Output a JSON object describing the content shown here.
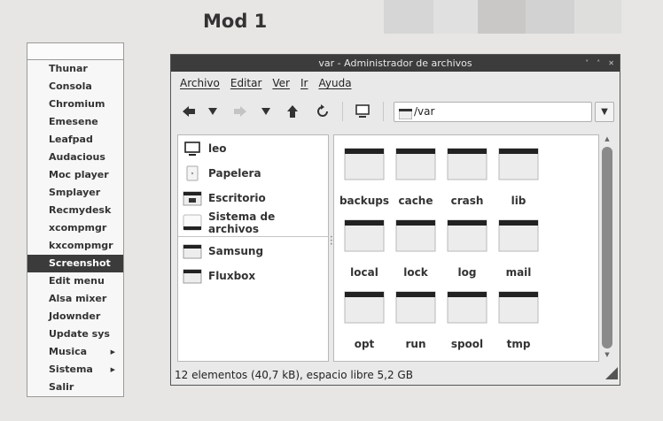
{
  "desktop": {
    "title": "Mod 1",
    "swatches": [
      "#d6d6d6",
      "#e0e0e0",
      "#c9c8c6",
      "#d2d2d2",
      "#dededd"
    ]
  },
  "rootmenu": {
    "items": [
      {
        "label": "Thunar"
      },
      {
        "label": "Consola"
      },
      {
        "label": "Chromium"
      },
      {
        "label": "Emesene"
      },
      {
        "label": "Leafpad"
      },
      {
        "label": "Audacious"
      },
      {
        "label": "Moc player"
      },
      {
        "label": "Smplayer"
      },
      {
        "label": "Recmydesk"
      },
      {
        "label": "xcompmgr"
      },
      {
        "label": "kxcompmgr"
      },
      {
        "label": "Screenshot",
        "active": true
      },
      {
        "label": "Edit menu"
      },
      {
        "label": "Alsa mixer"
      },
      {
        "label": "Jdownder"
      },
      {
        "label": "Update sys"
      },
      {
        "label": "Musica",
        "submenu": true
      },
      {
        "label": "Sistema",
        "submenu": true
      },
      {
        "label": "Salir"
      }
    ]
  },
  "window": {
    "title": "var - Administrador de archivos",
    "menubar": [
      "Archivo",
      "Editar",
      "Ver",
      "Ir",
      "Ayuda"
    ],
    "path": "/var",
    "places": [
      {
        "label": "leo",
        "icon": "computer-icon"
      },
      {
        "label": "Papelera",
        "icon": "trash-icon"
      },
      {
        "label": "Escritorio",
        "icon": "desktop-folder-icon"
      },
      {
        "label": "Sistema de archivos",
        "icon": "drive-icon"
      },
      {
        "label": "Samsung",
        "icon": "folder-icon"
      },
      {
        "label": "Fluxbox",
        "icon": "folder-icon"
      }
    ],
    "files": [
      "backups",
      "cache",
      "crash",
      "lib",
      "local",
      "lock",
      "log",
      "mail",
      "opt",
      "run",
      "spool",
      "tmp"
    ],
    "status": "12 elementos (40,7 kB), espacio libre 5,2 GB"
  }
}
